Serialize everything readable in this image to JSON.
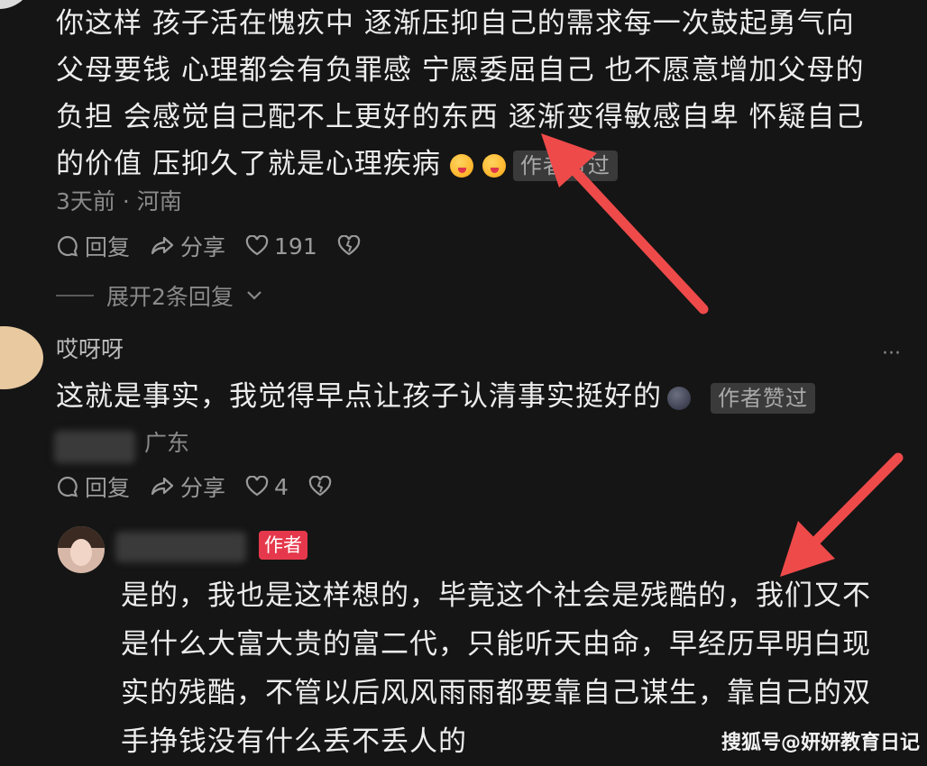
{
  "comment1": {
    "lines": [
      "你这样 孩子活在愧疚中 逐渐压抑自己的需求每一次鼓起勇气向",
      "父母要钱 心理都会有负罪感 宁愿委屈自己 也不愿意增加父母的",
      "负担 会感觉自己配不上更好的东西 逐渐变得敏感自卑 怀疑自己",
      "的价值 压抑久了就是心理疾病"
    ],
    "badge": "作者赞过",
    "meta": "3天前 · 河南",
    "reply": "回复",
    "share": "分享",
    "likes": "191",
    "expand": "展开2条回复"
  },
  "comment2": {
    "username": "哎呀呀",
    "text": "这就是事实，我觉得早点让孩子认清事实挺好的",
    "badge": "作者赞过",
    "location": "广东",
    "reply": "回复",
    "share": "分享",
    "likes": "4",
    "more": "···"
  },
  "reply": {
    "author_badge": "作者",
    "lines": [
      "是的，我也是这样想的，毕竟这个社会是残酷的，我们又不",
      "是什么大富大贵的富二代，只能听天由命，早经历早明白现",
      "实的残酷，不管以后风风雨雨都要靠自己谋生，靠自己的双",
      "手挣钱没有什么丢不丢人的"
    ]
  },
  "watermark": "搜狐号@妍妍教育日记",
  "colors": {
    "background": "#151515",
    "arrow": "#ef4a4a",
    "author_badge": "#e5384c"
  }
}
